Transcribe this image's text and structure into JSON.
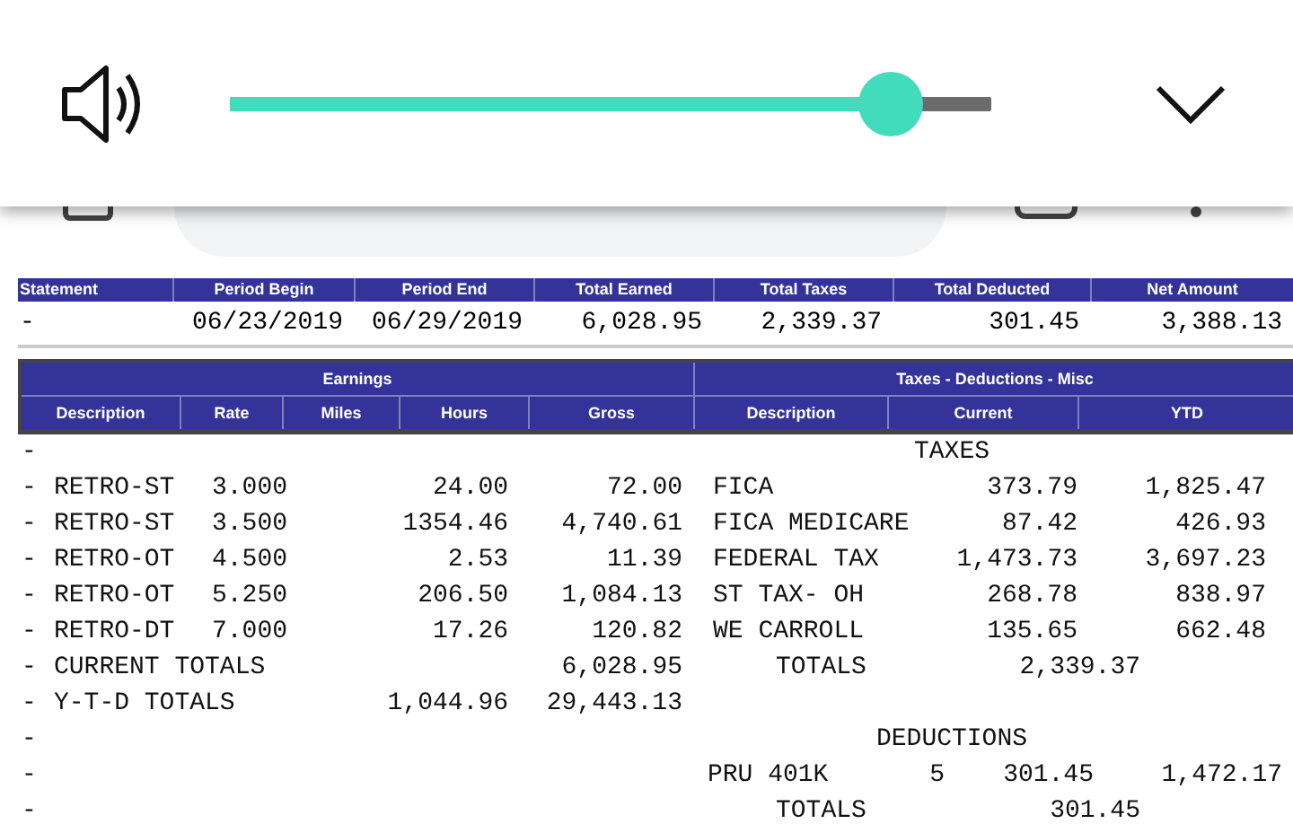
{
  "volume_panel": {
    "level": 0.868
  },
  "summary": {
    "columns": [
      "Statement",
      "Period Begin",
      "Period End",
      "Total Earned",
      "Total Taxes",
      "Total Deducted",
      "Net Amount"
    ],
    "row": [
      "-",
      "06/23/2019",
      "06/29/2019",
      "6,028.95",
      "2,339.37",
      "301.45",
      "3,388.13"
    ]
  },
  "earnings": {
    "title": "Earnings",
    "columns": [
      "Description",
      "Rate",
      "Miles",
      "Hours",
      "Gross"
    ]
  },
  "taxes": {
    "title": "Taxes - Deductions - Misc",
    "columns": [
      "Description",
      "Current",
      "YTD"
    ]
  },
  "rows": [
    {
      "marker": "-",
      "right": {
        "kind": "heading",
        "text": "TAXES"
      }
    },
    {
      "marker": "-",
      "description": "RETRO-ST",
      "rate": "3.000",
      "hours": "24.00",
      "gross": "72.00",
      "right": {
        "kind": "item",
        "description": "FICA",
        "current": "373.79",
        "ytd": "1,825.47"
      }
    },
    {
      "marker": "-",
      "description": "RETRO-ST",
      "rate": "3.500",
      "hours": "1354.46",
      "gross": "4,740.61",
      "right": {
        "kind": "item",
        "description": "FICA MEDICARE",
        "current": "87.42",
        "ytd": "426.93"
      }
    },
    {
      "marker": "-",
      "description": "RETRO-OT",
      "rate": "4.500",
      "hours": "2.53",
      "gross": "11.39",
      "right": {
        "kind": "item",
        "description": "FEDERAL TAX",
        "current": "1,473.73",
        "ytd": "3,697.23"
      }
    },
    {
      "marker": "-",
      "description": "RETRO-OT",
      "rate": "5.250",
      "hours": "206.50",
      "gross": "1,084.13",
      "right": {
        "kind": "item",
        "description": "ST TAX- OH",
        "current": "268.78",
        "ytd": "838.97"
      }
    },
    {
      "marker": "-",
      "description": "RETRO-DT",
      "rate": "7.000",
      "hours": "17.26",
      "gross": "120.82",
      "right": {
        "kind": "item",
        "description": "WE CARROLL",
        "current": "135.65",
        "ytd": "662.48"
      }
    },
    {
      "marker": "-",
      "description": "CURRENT TOTALS",
      "gross": "6,028.95",
      "right": {
        "kind": "total",
        "description": "TOTALS",
        "current": "2,339.37"
      }
    },
    {
      "marker": "-",
      "description": "Y-T-D TOTALS",
      "hours": "1,044.96",
      "gross": "29,443.13"
    },
    {
      "marker": "-",
      "right": {
        "kind": "heading",
        "text": "DEDUCTIONS"
      }
    },
    {
      "marker": "-",
      "right": {
        "kind": "deduction",
        "description": "PRU 401K",
        "code": "5",
        "current": "301.45",
        "ytd": "1,472.17"
      }
    },
    {
      "marker": "-",
      "right": {
        "kind": "total",
        "description": "TOTALS",
        "current": "301.45"
      }
    }
  ]
}
